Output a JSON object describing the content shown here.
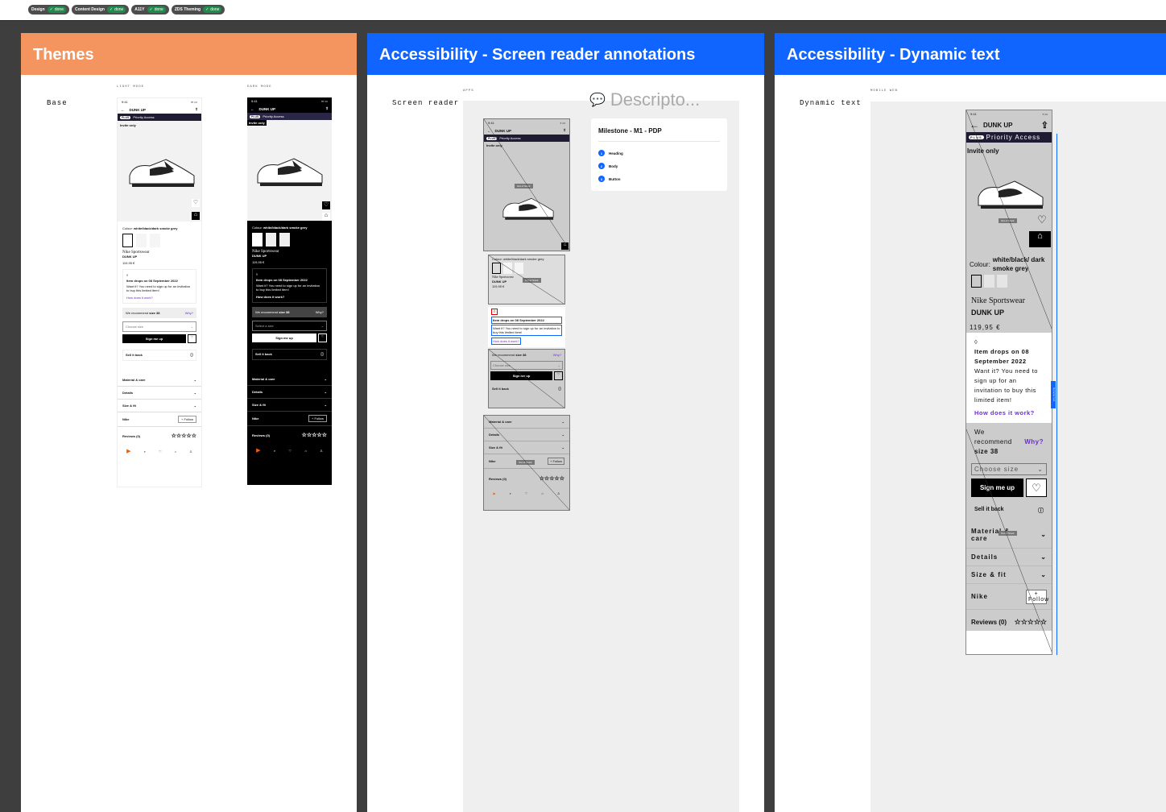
{
  "chips": [
    {
      "label": "Design",
      "status": "done"
    },
    {
      "label": "Content Design",
      "status": "done"
    },
    {
      "label": "A11Y",
      "status": "done"
    },
    {
      "label": "ZDS Theming",
      "status": "done"
    }
  ],
  "colors": {
    "themes_header": "#f4955f",
    "a11y_header": "#1064ff",
    "done": "#1f8b4c",
    "canvas": "#3e3e3e"
  },
  "themes": {
    "title": "Themes",
    "row_label": "Base",
    "light_label": "LIGHT MODE",
    "dark_label": "DARK MODE",
    "light": {
      "time": "9:41",
      "title": "DUNK UP",
      "plus": "PLUS",
      "priority": "Priority Access",
      "invite": "Invite only",
      "colour_label": "Colour:",
      "colour_value": "white/black/dark smoke grey",
      "brand": "Nike Sportswear",
      "name": "DUNK UP",
      "price": "119,95 €",
      "drop_title": "Item drops on 08 September 2022",
      "drop_text": "Want it? You need to sign up for an invitation to buy this limited item!",
      "drop_link": "How does it work?",
      "recommend": "We recommend",
      "rec_size": "size 38",
      "why": "Why?",
      "choose": "Choose size",
      "signup": "Sign me up",
      "sell": "Sell it back",
      "acc1": "Material & care",
      "acc2": "Details",
      "acc3": "Size & fit",
      "nike": "Nike",
      "follow": "Follow",
      "reviews": "Reviews (0)"
    },
    "dark": {
      "time": "9:41",
      "title": "DUNK UP",
      "plus": "PLUS",
      "priority": "Priority Access",
      "invite": "Invite only",
      "colour_label": "Colour:",
      "colour_value": "white/black/dark smoke grey",
      "brand": "Nike Sportswear",
      "name": "DUNK UP",
      "price": "119,95 €",
      "drop_title": "Item drops on 08 September 2022",
      "drop_text": "Want it? You need to sign up for an invitation to buy this limited item!",
      "drop_link": "How does it work?",
      "recommend": "We recommend",
      "rec_size": "size 38",
      "why": "Why?",
      "choose": "Select a size",
      "signup": "Sign me up",
      "sell": "Sell it back",
      "acc1": "Material & care",
      "acc2": "Details",
      "acc3": "Size & fit",
      "nike": "Nike",
      "follow": "Follow",
      "reviews": "Reviews (0)"
    }
  },
  "screen_reader": {
    "title": "Accessibility - Screen reader annotations",
    "row_label": "Screen reader",
    "apps_label": "APPS",
    "descriptor_placeholder": "Descripto...",
    "oos": "Out of Stock",
    "time": "9:41",
    "nav_title": "DUNK UP",
    "plus": "PLUS",
    "priority": "Priority Access",
    "invite": "Invite only",
    "colour": "Colour: white/black/dark smoke grey",
    "brand": "Nike Sportswear",
    "name": "DUNK UP",
    "price": "119,95 €",
    "drop_title": "Item drops on 08 September 2022",
    "drop_text": "Want it? You need to sign up for an invitation to buy this limited item!",
    "drop_link": "How does it work?",
    "recommend": "We recommend",
    "rec_size": "size 38",
    "why": "Why?",
    "choose": "Choose size",
    "signup": "Sign me up",
    "sell": "Sell it back",
    "acc1": "Material & care",
    "acc2": "Details",
    "acc3": "Size & fit",
    "nike": "Nike",
    "follow": "Follow",
    "reviews": "Reviews (0)",
    "milestone": {
      "title": "Milestone - M1 - PDP",
      "items": [
        {
          "n": "1",
          "label": "Heading"
        },
        {
          "n": "2",
          "label": "Body"
        },
        {
          "n": "3",
          "label": "Button"
        }
      ]
    }
  },
  "dynamic": {
    "title": "Accessibility - Dynamic text",
    "row_label": "Dynamic text",
    "mobile_label": "MOBILE WEB",
    "oos": "Out of Stock",
    "side_label": "Dynamic text",
    "time": "9:41",
    "nav_title": "DUNK UP",
    "plus": "PLUS",
    "priority": "Priority Access",
    "invite": "Invite only",
    "colour_label": "Colour:",
    "colour_value": "white/black/ dark smoke grey",
    "brand": "Nike Sportswear",
    "name": "DUNK UP",
    "price": "119,95 €",
    "drop_title": "Item drops on 08 September 2022",
    "drop_text": "Want it? You need to sign up for an invitation to buy this limited item!",
    "drop_link": "How does it work?",
    "recommend": "We recommend",
    "rec_size": "size 38",
    "why": "Why?",
    "choose": "Choose size",
    "signup": "Sign me up",
    "sell": "Sell it back",
    "acc1": "Material & care",
    "acc2": "Details",
    "acc3": "Size & fit",
    "nike": "Nike",
    "follow": "Follow",
    "reviews": "Reviews (0)"
  }
}
